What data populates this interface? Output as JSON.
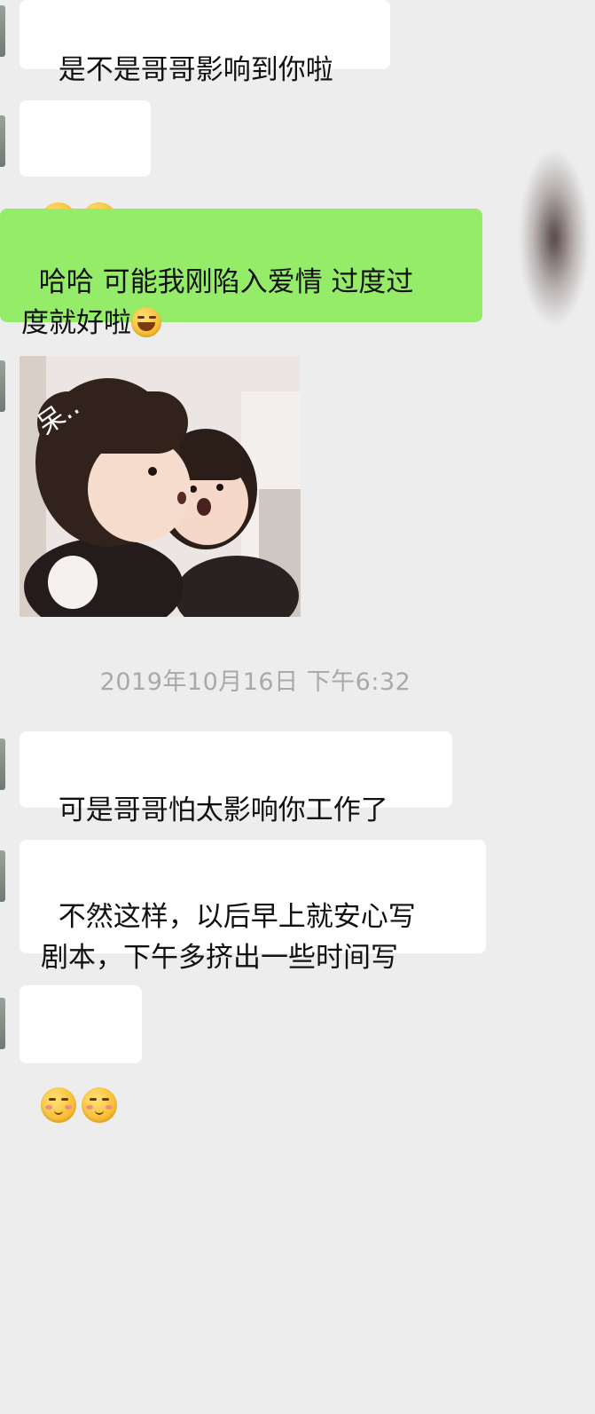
{
  "messages": [
    {
      "type": "text",
      "side": "left",
      "text": "是不是哥哥影响到你啦"
    },
    {
      "type": "emoji",
      "side": "left",
      "emojis": [
        "laughing-tears-emoji",
        "laughing-tears-emoji"
      ]
    },
    {
      "type": "text",
      "side": "right",
      "text": "哈哈 可能我刚陷入爱情 过度过\n度就好啦",
      "trailing_emoji": "laughing-tears-emoji"
    },
    {
      "type": "sticker",
      "side": "left",
      "caption": "呆.."
    },
    {
      "type": "timestamp",
      "text": "2019年10月16日 下午6:32"
    },
    {
      "type": "text",
      "side": "left",
      "text": "可是哥哥怕太影响你工作了"
    },
    {
      "type": "text",
      "side": "left",
      "text": "不然这样，以后早上就安心写\n剧本，下午多挤出一些时间写"
    },
    {
      "type": "emoji",
      "side": "left",
      "emojis": [
        "shy-smile-emoji",
        "shy-smile-emoji"
      ]
    }
  ],
  "colors": {
    "background": "#ededed",
    "bubble_left": "#ffffff",
    "bubble_right": "#95ec69",
    "timestamp_text": "#a9a9a9"
  }
}
